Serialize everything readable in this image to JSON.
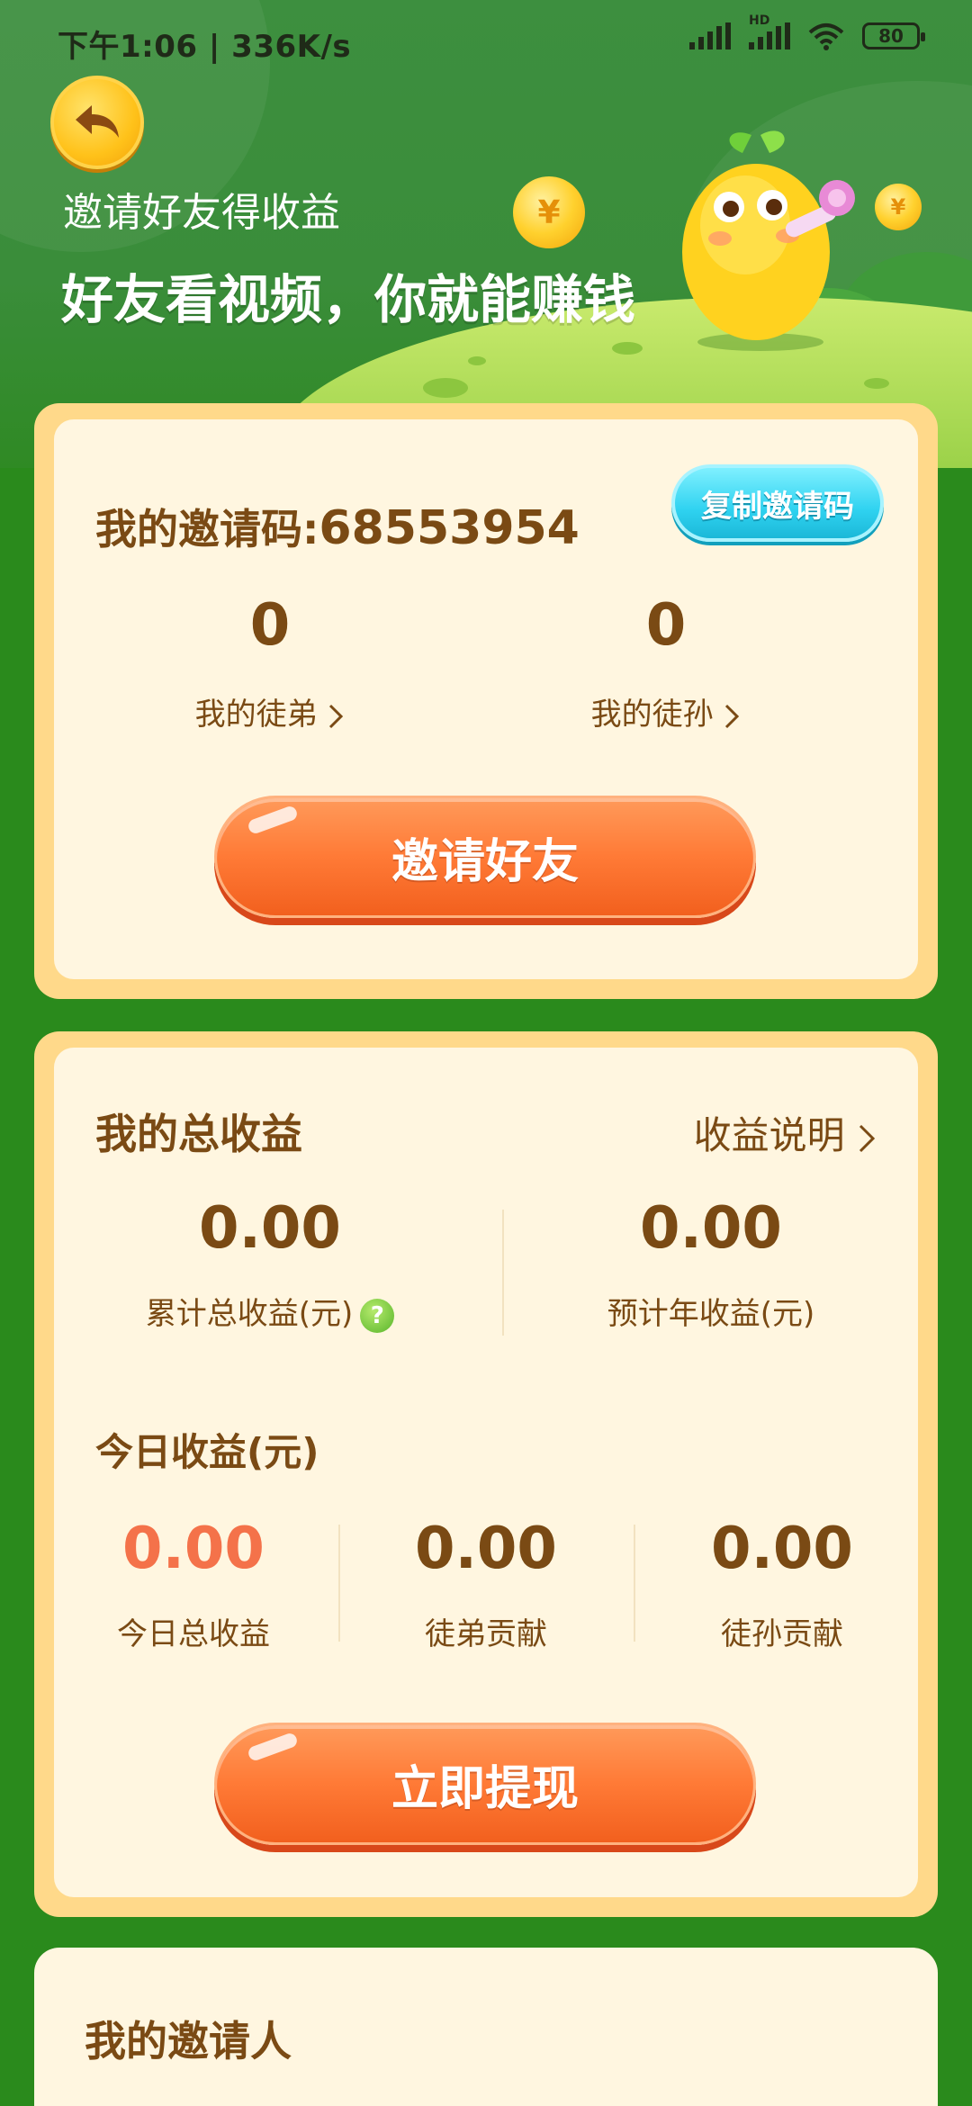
{
  "status_bar": {
    "time_speed": "下午1:06 | 336K/s",
    "network_badge": "HD",
    "battery": "80"
  },
  "header": {
    "subtitle": "邀请好友得收益",
    "title": "好友看视频，你就能赚钱",
    "coin_symbol": "¥"
  },
  "invite": {
    "code_label": "我的邀请码:",
    "code_value": "68553954",
    "copy_button": "复制邀请码",
    "disciples_count": "0",
    "disciples_label": "我的徒弟",
    "grand_disciples_count": "0",
    "grand_disciples_label": "我的徒孙",
    "invite_button": "邀请好友"
  },
  "income": {
    "section_title": "我的总收益",
    "explain_link": "收益说明",
    "total_value": "0.00",
    "total_label": "累计总收益(元)",
    "yearly_value": "0.00",
    "yearly_label": "预计年收益(元)",
    "today_title": "今日收益(元)",
    "today_total_value": "0.00",
    "today_total_label": "今日总收益",
    "disciple_value": "0.00",
    "disciple_label": "徒弟贡献",
    "grand_value": "0.00",
    "grand_label": "徒孙贡献",
    "withdraw_button": "立即提现",
    "highlight_color": "#f4724a"
  },
  "inviter": {
    "title": "我的邀请人"
  },
  "icons": [
    "back-arrow-icon",
    "chevron-right-icon",
    "help-icon",
    "signal-icon",
    "wifi-icon",
    "battery-icon",
    "coin-icon",
    "mascot-icon"
  ]
}
